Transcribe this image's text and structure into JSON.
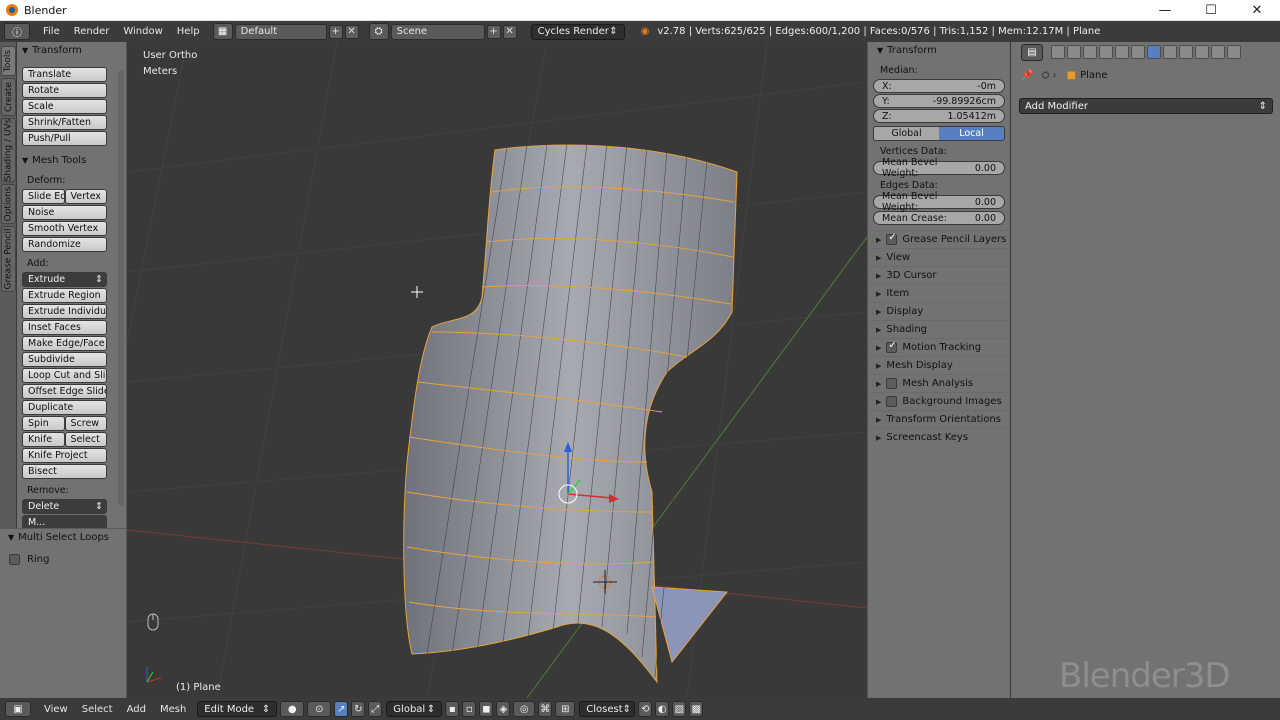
{
  "window": {
    "title": "Blender",
    "minimize": "—",
    "maximize": "☐",
    "close": "✕"
  },
  "infobar": {
    "menus": [
      "File",
      "Render",
      "Window",
      "Help"
    ],
    "layout": "Default",
    "scene": "Scene",
    "engine": "Cycles Render",
    "stats": "v2.78 | Verts:625/625 | Edges:600/1,200 | Faces:0/576 | Tris:1,152 | Mem:12.17M | Plane"
  },
  "left_tabs": [
    "Tools",
    "Create",
    "Shading / UVs",
    "Options",
    "Grease Pencil"
  ],
  "toolshelf": {
    "transform_title": "Transform",
    "transform_buttons": [
      "Translate",
      "Rotate",
      "Scale",
      "Shrink/Fatten",
      "Push/Pull"
    ],
    "mesh_tools_title": "Mesh Tools",
    "deform_label": "Deform:",
    "slide_edge": "Slide Ed",
    "vertex": "Vertex",
    "deform_buttons": [
      "Noise",
      "Smooth Vertex",
      "Randomize"
    ],
    "add_label": "Add:",
    "extrude": "Extrude",
    "add_buttons": [
      "Extrude Region",
      "Extrude Individual",
      "Inset Faces",
      "Make Edge/Face",
      "Subdivide",
      "Loop Cut and Sli...",
      "Offset Edge Slide",
      "Duplicate"
    ],
    "spin": "Spin",
    "screw": "Screw",
    "knife": "Knife",
    "select": "Select",
    "knife_project": "Knife Project",
    "bisect": "Bisect",
    "remove_label": "Remove:",
    "delete": "Delete",
    "merge_partial": "M..."
  },
  "operator_panel": {
    "title": "Multi Select Loops",
    "ring_label": "Ring"
  },
  "viewport": {
    "view_name": "User Ortho",
    "units": "Meters",
    "object_label": "(1) Plane"
  },
  "npanel": {
    "transform_title": "Transform",
    "median_label": "Median:",
    "x_label": "X:",
    "x_value": "-0m",
    "y_label": "Y:",
    "y_value": "-99.89926cm",
    "z_label": "Z:",
    "z_value": "1.05412m",
    "global": "Global",
    "local": "Local",
    "vertices_data": "Vertices Data:",
    "mean_bevel_weight": "Mean Bevel Weight:",
    "vert_bevel_value": "0.00",
    "edges_data": "Edges Data:",
    "edge_bevel_value": "0.00",
    "mean_crease": "Mean Crease:",
    "crease_value": "0.00",
    "panels": [
      {
        "label": "Grease Pencil Layers",
        "checkbox": true
      },
      {
        "label": "View",
        "checkbox": false
      },
      {
        "label": "3D Cursor",
        "checkbox": false
      },
      {
        "label": "Item",
        "checkbox": false
      },
      {
        "label": "Display",
        "checkbox": false
      },
      {
        "label": "Shading",
        "checkbox": false
      },
      {
        "label": "Motion Tracking",
        "checkbox": true
      },
      {
        "label": "Mesh Display",
        "checkbox": false
      },
      {
        "label": "Mesh Analysis",
        "checkbox": "off"
      },
      {
        "label": "Background Images",
        "checkbox": "off"
      },
      {
        "label": "Transform Orientations",
        "checkbox": false
      },
      {
        "label": "Screencast Keys",
        "checkbox": false
      }
    ]
  },
  "properties": {
    "object_name": "Plane",
    "add_modifier": "Add Modifier"
  },
  "watermark": "Blender3D",
  "bottombar": {
    "menus": [
      "View",
      "Select",
      "Add",
      "Mesh"
    ],
    "mode": "Edit Mode",
    "orientation": "Global",
    "snap_target": "Closest"
  },
  "colors": {
    "accent": "#5680c2",
    "edges": "#e8a33a",
    "mesh": "#8e9099",
    "viewport_bg": "#393939"
  }
}
